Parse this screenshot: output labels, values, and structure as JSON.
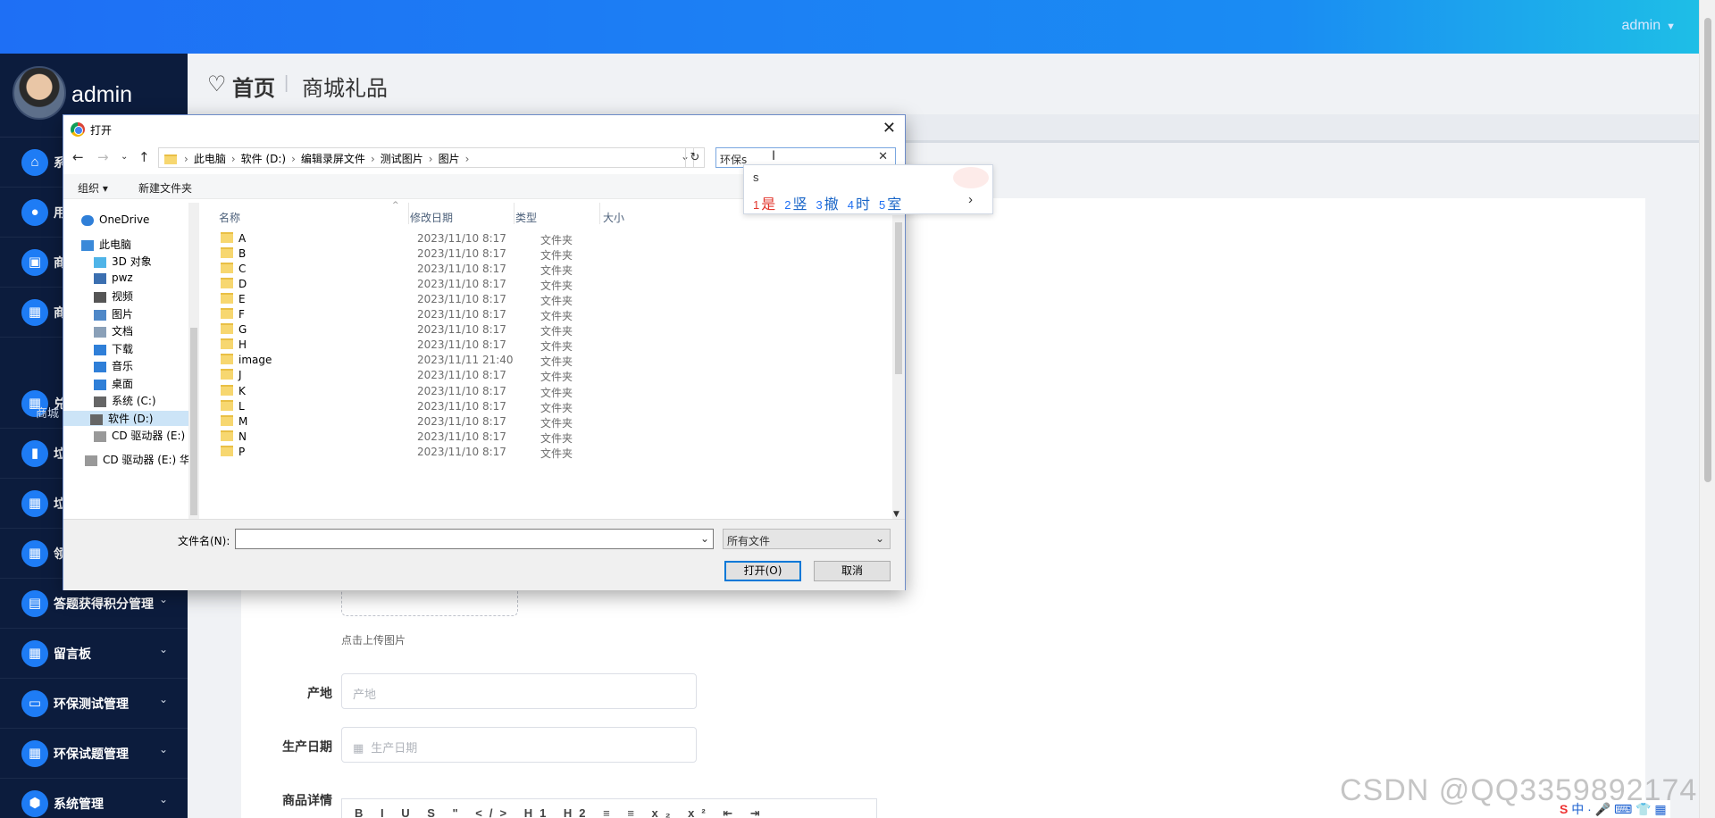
{
  "topbar": {
    "user": "admin",
    "caret": "▼"
  },
  "sidebar": {
    "username": "admin",
    "items": [
      {
        "label": "系",
        "icon": "home-icon"
      },
      {
        "label": "用",
        "icon": "user-icon"
      },
      {
        "label": "商",
        "icon": "briefcase-icon"
      },
      {
        "label": "商",
        "icon": "grid-icon"
      },
      {
        "label": "兑",
        "icon": "grid-icon"
      },
      {
        "label": "垃",
        "icon": "bar-chart-icon"
      },
      {
        "label": "垃",
        "icon": "grid-icon"
      },
      {
        "label": "领",
        "icon": "grid-icon"
      },
      {
        "label": "答题获得积分管理",
        "icon": "clipboard-icon"
      },
      {
        "label": "留言板",
        "icon": "grid-icon"
      },
      {
        "label": "环保测试管理",
        "icon": "monitor-icon"
      },
      {
        "label": "环保试题管理",
        "icon": "grid-icon"
      },
      {
        "label": "系统管理",
        "icon": "pin-icon"
      }
    ],
    "submenu_label": "商城"
  },
  "breadcrumb": {
    "home": "首页",
    "separator": "|",
    "current": "商城礼品"
  },
  "form": {
    "upload_hint": "点击上传图片",
    "origin_label": "产地",
    "origin_placeholder": "产地",
    "date_label": "生产日期",
    "date_placeholder": "生产日期",
    "detail_label": "商品详情",
    "editor_toolbar": "B I U S \" </> H1 H2 ≡ ≡ x₂ x² ⇤ ⇥"
  },
  "dialog": {
    "title": "打开",
    "path": [
      "此电脑",
      "软件 (D:)",
      "编辑录屏文件",
      "测试图片",
      "图片"
    ],
    "search_value": "环保s",
    "toolbar": {
      "organize": "组织 ▾",
      "new_folder": "新建文件夹"
    },
    "nav": [
      {
        "label": "OneDrive",
        "icon": "cloud-icon"
      },
      {
        "label": "此电脑",
        "icon": "computer-icon"
      },
      {
        "label": "3D 对象",
        "icon": "cube-icon"
      },
      {
        "label": "pwz",
        "icon": "phone-icon"
      },
      {
        "label": "视频",
        "icon": "video-icon"
      },
      {
        "label": "图片",
        "icon": "picture-icon"
      },
      {
        "label": "文档",
        "icon": "document-icon"
      },
      {
        "label": "下载",
        "icon": "download-icon"
      },
      {
        "label": "音乐",
        "icon": "music-icon"
      },
      {
        "label": "桌面",
        "icon": "desktop-icon"
      },
      {
        "label": "系统 (C:)",
        "icon": "drive-icon"
      },
      {
        "label": "软件 (D:)",
        "icon": "drive-icon"
      },
      {
        "label": "CD 驱动器 (E:) 4",
        "icon": "cd-icon"
      },
      {
        "label": "CD 驱动器 (E:) 华",
        "icon": "cd-icon"
      }
    ],
    "columns": {
      "name": "名称",
      "modified": "修改日期",
      "type": "类型",
      "size": "大小"
    },
    "files": [
      {
        "name": "A",
        "modified": "2023/11/10 8:17",
        "type": "文件夹"
      },
      {
        "name": "B",
        "modified": "2023/11/10 8:17",
        "type": "文件夹"
      },
      {
        "name": "C",
        "modified": "2023/11/10 8:17",
        "type": "文件夹"
      },
      {
        "name": "D",
        "modified": "2023/11/10 8:17",
        "type": "文件夹"
      },
      {
        "name": "E",
        "modified": "2023/11/10 8:17",
        "type": "文件夹"
      },
      {
        "name": "F",
        "modified": "2023/11/10 8:17",
        "type": "文件夹"
      },
      {
        "name": "G",
        "modified": "2023/11/10 8:17",
        "type": "文件夹"
      },
      {
        "name": "H",
        "modified": "2023/11/10 8:17",
        "type": "文件夹"
      },
      {
        "name": "image",
        "modified": "2023/11/11 21:40",
        "type": "文件夹"
      },
      {
        "name": "J",
        "modified": "2023/11/10 8:17",
        "type": "文件夹"
      },
      {
        "name": "K",
        "modified": "2023/11/10 8:17",
        "type": "文件夹"
      },
      {
        "name": "L",
        "modified": "2023/11/10 8:17",
        "type": "文件夹"
      },
      {
        "name": "M",
        "modified": "2023/11/10 8:17",
        "type": "文件夹"
      },
      {
        "name": "N",
        "modified": "2023/11/10 8:17",
        "type": "文件夹"
      },
      {
        "name": "P",
        "modified": "2023/11/10 8:17",
        "type": "文件夹"
      }
    ],
    "filename_label": "文件名(N):",
    "filename_value": "",
    "filetype": "所有文件",
    "open_button": "打开(O)",
    "cancel_button": "取消"
  },
  "ime": {
    "typed": "s",
    "candidates": [
      {
        "n": "1",
        "c": "是"
      },
      {
        "n": "2",
        "c": "竖"
      },
      {
        "n": "3",
        "c": "撤"
      },
      {
        "n": "4",
        "c": "时"
      },
      {
        "n": "5",
        "c": "室"
      }
    ],
    "more": "›"
  },
  "watermark": "CSDN @QQ3359892174",
  "tray": "中 · 🎤 ⌨ 👕 ▦"
}
